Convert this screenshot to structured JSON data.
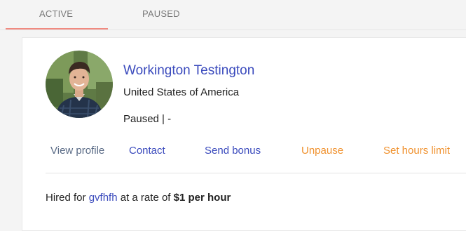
{
  "tabs": [
    {
      "label": "ACTIVE",
      "active": true
    },
    {
      "label": "PAUSED",
      "active": false
    }
  ],
  "accent_color": "#f08a80",
  "freelancer": {
    "name": "Workington Testington",
    "country": "United States of America",
    "status": "Paused | -",
    "avatar_icon": "profile-photo"
  },
  "actions": {
    "view_profile": "View profile",
    "contact": "Contact",
    "send_bonus": "Send bonus",
    "unpause": "Unpause",
    "set_hours_limit": "Set hours limit"
  },
  "contract": {
    "prefix": "Hired for",
    "job_title": "gvfhfh",
    "rate_prefix": "at a rate of",
    "rate": "$1",
    "rate_suffix": "per hour"
  }
}
